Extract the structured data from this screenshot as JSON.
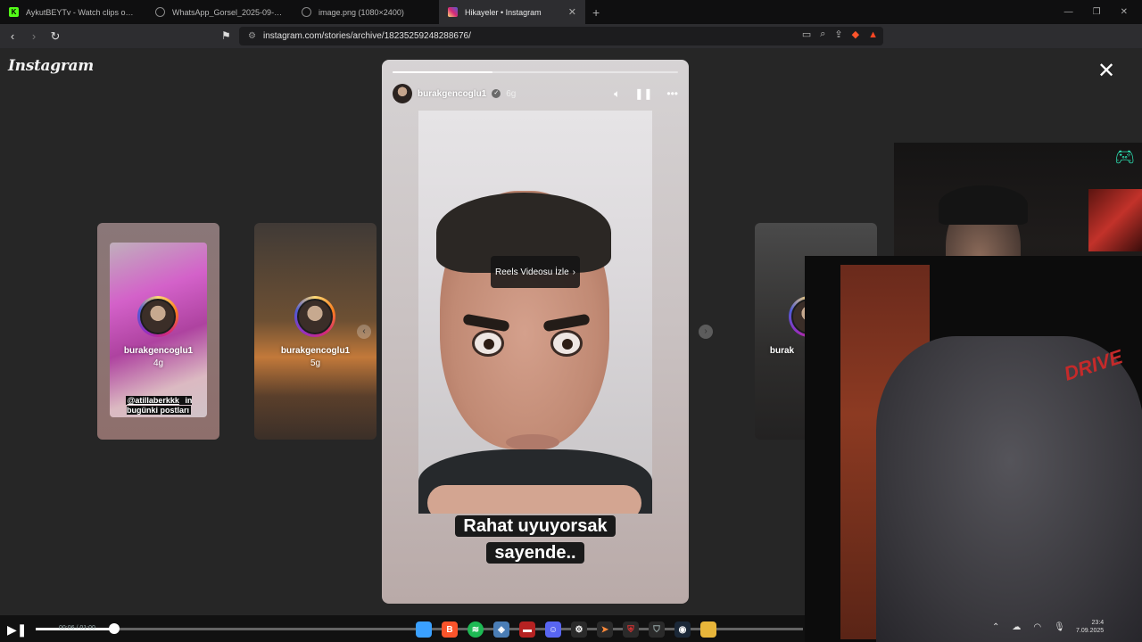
{
  "tabs": [
    {
      "label": "AykutBEYTv - Watch clips on Kick",
      "favicon": "kick-icon",
      "favicon_color": "#53fc18",
      "active": false
    },
    {
      "label": "WhatsApp_Gorsel_2025-09-05_saat_",
      "favicon": "globe-icon",
      "favicon_color": "#888888",
      "active": false
    },
    {
      "label": "image.png (1080×2400)",
      "favicon": "globe-icon",
      "favicon_color": "#888888",
      "active": false
    },
    {
      "label": "Hikayeler • Instagram",
      "favicon": "instagram-icon",
      "favicon_color": "#e1306c",
      "active": true
    }
  ],
  "url": "instagram.com/stories/archive/18235259248288676/",
  "app_logo": "Instagram",
  "side_stories": [
    {
      "username": "burakgencoglu1",
      "time": "4g",
      "caption_mention": "@atillaberkkk",
      "caption_rest": " in bugünki postları"
    },
    {
      "username": "burakgencoglu1",
      "time": "5g"
    },
    {
      "username": "burak"
    }
  ],
  "main_story": {
    "username": "burakgencoglu1",
    "time": "6g",
    "progress": 0.35,
    "reels_button": "Reels Videosu İzle",
    "caption_line1": "Rahat uyuyorsak",
    "caption_line2": "sayende.."
  },
  "webcam_brand": "DRIVE",
  "player": {
    "time": "00:06 / 01:00",
    "progress": 0.1
  },
  "clock": {
    "time": "23:4",
    "date": "7.09.2025"
  },
  "colors": {
    "accent_story_ring": "#d62976",
    "background": "#262626",
    "progress_fill": "#ffffff"
  }
}
